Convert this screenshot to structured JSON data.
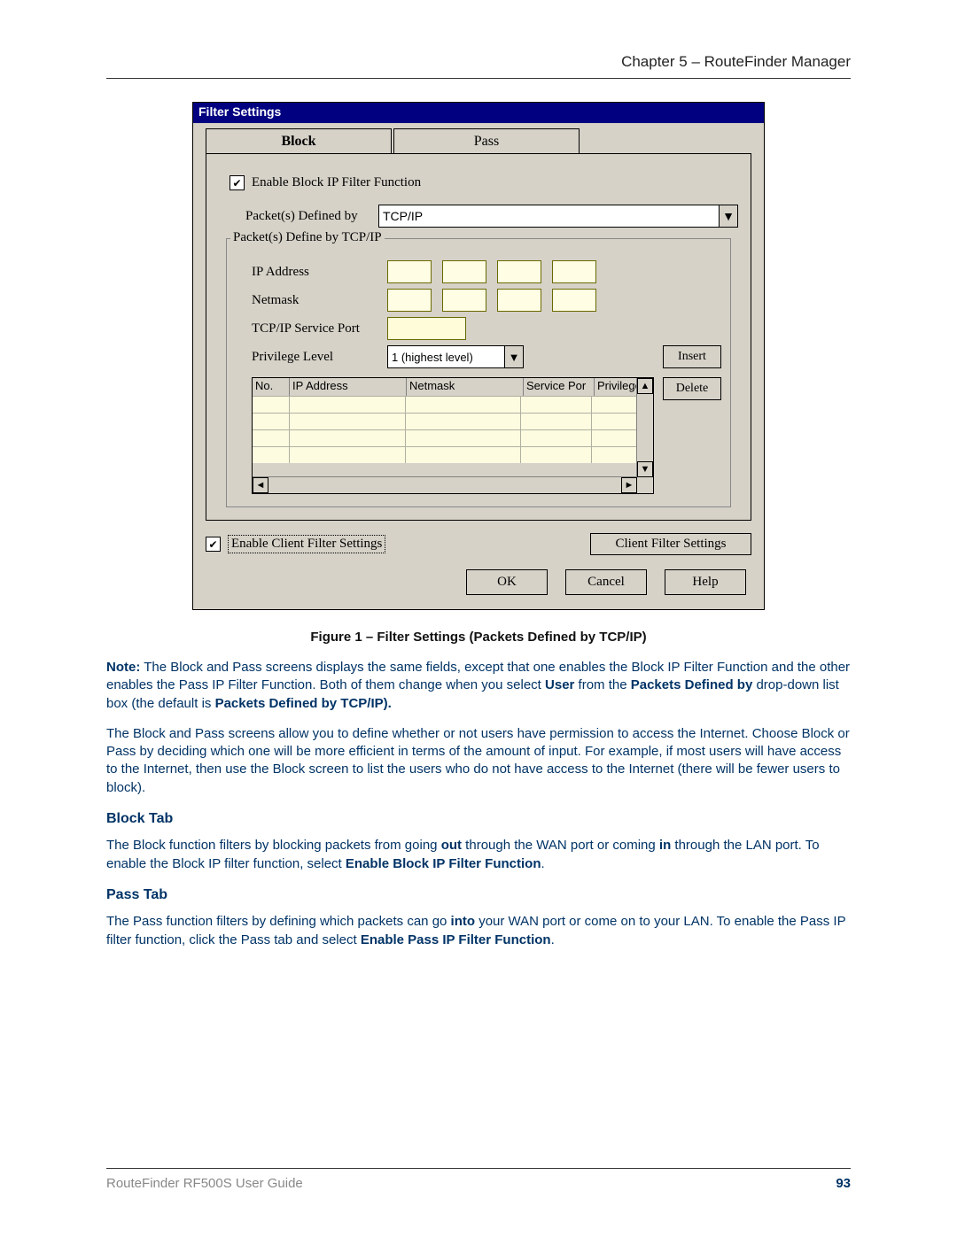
{
  "header": {
    "chapter": "Chapter 5 – RouteFinder Manager"
  },
  "dialog": {
    "title": "Filter Settings",
    "tabs": {
      "block": "Block",
      "pass": "Pass"
    },
    "enable_block_label": "Enable Block IP Filter Function",
    "packets_defined_label": "Packet(s) Defined by",
    "packets_defined_value": "TCP/IP",
    "fieldset_legend": "Packet(s) Define by TCP/IP",
    "ip_address_label": "IP Address",
    "netmask_label": "Netmask",
    "service_port_label": "TCP/IP Service Port",
    "privilege_label": "Privilege Level",
    "privilege_value": "1 (highest level)",
    "buttons": {
      "insert": "Insert",
      "delete": "Delete"
    },
    "grid_cols": {
      "no": "No.",
      "ip": "IP Address",
      "netmask": "Netmask",
      "port": "Service Por",
      "priv": "Privilege"
    },
    "enable_client_label": "Enable Client Filter Settings",
    "client_filter_button": "Client Filter Settings",
    "ok": "OK",
    "cancel": "Cancel",
    "help": "Help"
  },
  "caption": "Figure 1 – Filter Settings (Packets Defined by TCP/IP)",
  "note": {
    "lead": "Note:",
    "p1a": " The Block and Pass screens displays the same fields, except that one enables the Block IP Filter Function and the other enables the Pass IP Filter Function. Both of them change when you select ",
    "user": "User",
    "p1b": " from the ",
    "pdb": "Packets Defined by",
    "p1c": " drop-down list box (the default is ",
    "pdbtcp": "Packets Defined by TCP/IP).",
    "p2": "The Block and Pass screens allow you to define whether or not users have permission to access the Internet. Choose Block or Pass by deciding which one will be more efficient in terms of the amount of input. For example, if most users will have access to the Internet, then use the Block screen to list the users who do not have access to the Internet (there will be fewer users to block)."
  },
  "block_tab": {
    "head": "Block Tab",
    "a": "The Block function filters by blocking packets from going ",
    "out": "out",
    "b": " through the WAN port or coming ",
    "in": "in",
    "c": " through the LAN port.  To enable the Block IP filter function, select ",
    "enable": "Enable Block IP Filter Function",
    "d": "."
  },
  "pass_tab": {
    "head": "Pass Tab",
    "a": "The Pass function filters by defining which packets can go ",
    "into": "into",
    "b": " your WAN port or come on to your LAN. To enable the Pass IP filter function, click the Pass tab and select ",
    "enable": "Enable Pass IP Filter Function",
    "c": "."
  },
  "footer": {
    "doc": "RouteFinder RF500S User Guide",
    "page": "93"
  }
}
